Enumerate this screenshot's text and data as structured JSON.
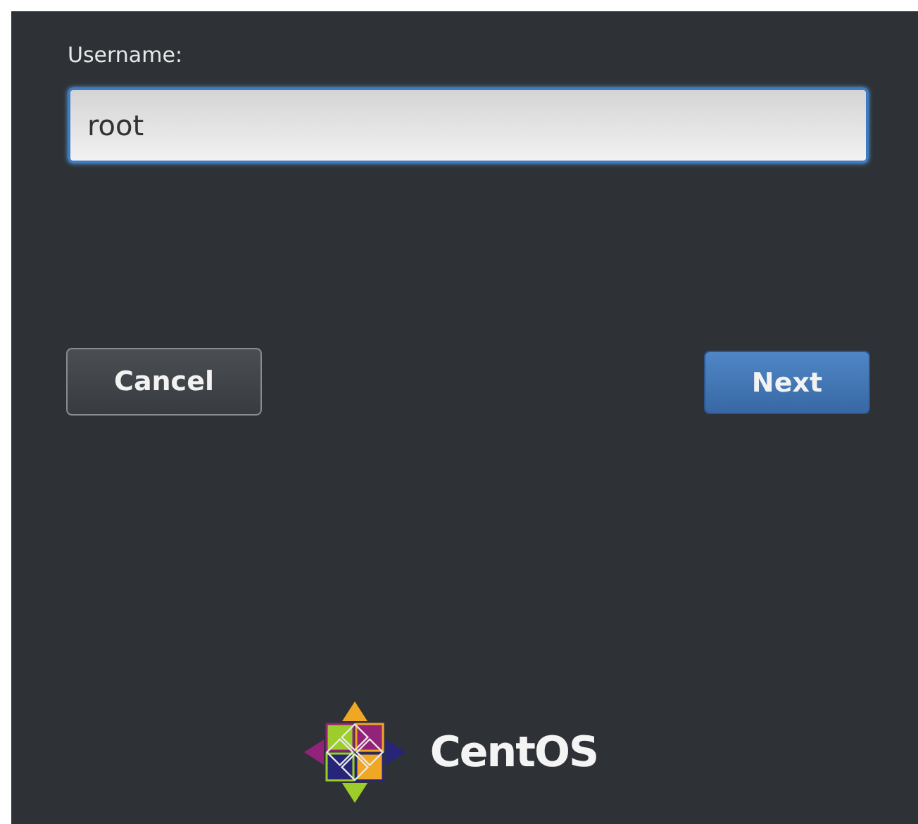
{
  "username": {
    "label": "Username:",
    "value": "root"
  },
  "buttons": [
    {
      "label": "Cancel",
      "kind": "secondary"
    },
    {
      "label": "Next",
      "kind": "primary"
    }
  ],
  "logo": {
    "name": "CentOS"
  }
}
